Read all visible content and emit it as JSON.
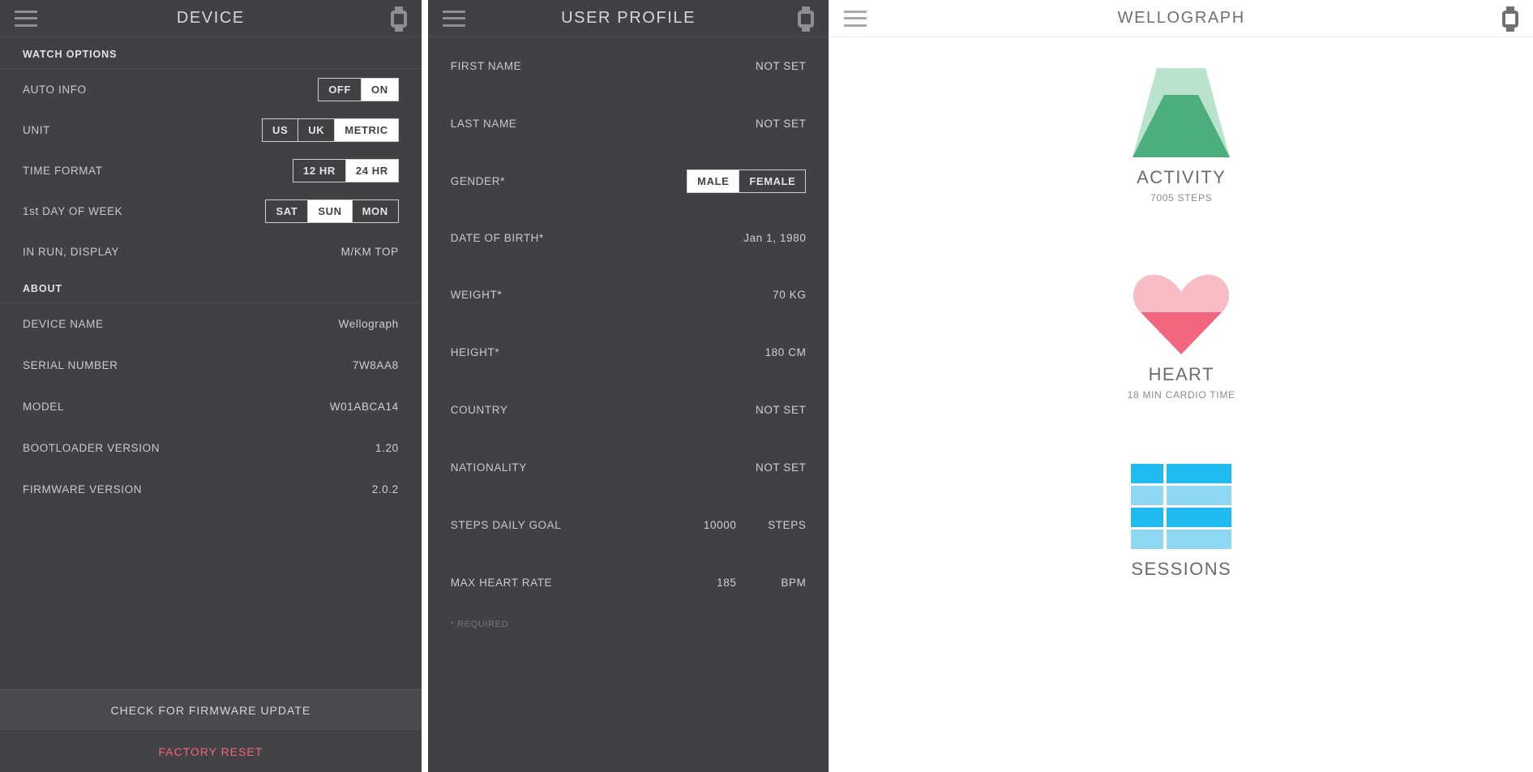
{
  "device_screen": {
    "header": {
      "title": "DEVICE",
      "menu_icon": "hamburger-menu-icon",
      "watch_icon": "watch-icon"
    },
    "sections": [
      {
        "heading": "WATCH OPTIONS",
        "rows": [
          {
            "label": "AUTO INFO",
            "type": "segmented",
            "options": [
              "OFF",
              "ON"
            ],
            "selected": "ON"
          },
          {
            "label": "UNIT",
            "type": "segmented",
            "options": [
              "US",
              "UK",
              "METRIC"
            ],
            "selected": "METRIC"
          },
          {
            "label": "TIME FORMAT",
            "type": "segmented",
            "options": [
              "12 HR",
              "24 HR"
            ],
            "selected": "24 HR"
          },
          {
            "label": "1st DAY OF WEEK",
            "type": "segmented",
            "options": [
              "SAT",
              "SUN",
              "MON"
            ],
            "selected": "SUN"
          },
          {
            "label": "IN RUN, DISPLAY",
            "type": "value",
            "value": "M/KM TOP"
          }
        ]
      },
      {
        "heading": "ABOUT",
        "rows": [
          {
            "label": "DEVICE NAME",
            "type": "value",
            "value": "Wellograph"
          },
          {
            "label": "SERIAL NUMBER",
            "type": "value",
            "value": "7W8AA8"
          },
          {
            "label": "MODEL",
            "type": "value",
            "value": "W01ABCA14"
          },
          {
            "label": "BOOTLOADER VERSION",
            "type": "value",
            "value": "1.20"
          },
          {
            "label": "FIRMWARE VERSION",
            "type": "value",
            "value": "2.0.2"
          }
        ]
      }
    ],
    "buttons": {
      "firmware_update": "CHECK FOR FIRMWARE UPDATE",
      "factory_reset": "FACTORY RESET",
      "factory_reset_color": "#f4637e"
    }
  },
  "profile_screen": {
    "header": {
      "title": "USER PROFILE",
      "menu_icon": "hamburger-menu-icon",
      "watch_icon": "watch-icon"
    },
    "rows": [
      {
        "label": "FIRST NAME",
        "type": "value",
        "value": "NOT SET"
      },
      {
        "label": "LAST NAME",
        "type": "value",
        "value": "NOT SET"
      },
      {
        "label": "GENDER*",
        "type": "segmented",
        "options": [
          "MALE",
          "FEMALE"
        ],
        "selected": "MALE"
      },
      {
        "label": "DATE OF BIRTH*",
        "type": "value",
        "value": "Jan 1, 1980"
      },
      {
        "label": "WEIGHT*",
        "type": "value",
        "value": "70 KG"
      },
      {
        "label": "HEIGHT*",
        "type": "value",
        "value": "180 CM"
      },
      {
        "label": "COUNTRY",
        "type": "value",
        "value": "NOT SET"
      },
      {
        "label": "NATIONALITY",
        "type": "value",
        "value": "NOT SET"
      },
      {
        "label": "STEPS DAILY GOAL",
        "type": "pair",
        "number": "10000",
        "unit": "STEPS"
      },
      {
        "label": "MAX HEART RATE",
        "type": "pair",
        "number": "185",
        "unit": "BPM"
      }
    ],
    "footnote": "* REQUIRED"
  },
  "dashboard_screen": {
    "header": {
      "title": "WELLOGRAPH",
      "menu_icon": "hamburger-menu-icon",
      "watch_icon": "watch-icon"
    },
    "metrics": [
      {
        "icon": "activity-trapezoid-icon",
        "title": "ACTIVITY",
        "subtitle": "7005 STEPS",
        "color_fill": "#4caf7d",
        "color_track": "#b9e3cc",
        "fill_ratio": 0.7
      },
      {
        "icon": "heart-icon",
        "title": "HEART",
        "subtitle": "18 MIN CARDIO TIME",
        "color_fill": "#f26680",
        "color_track": "#f7bcc4",
        "fill_ratio": 0.5
      },
      {
        "icon": "sessions-grid-icon",
        "title": "SESSIONS",
        "subtitle": "",
        "color_fill": "#1ebaf0",
        "color_track": "#8ed8f4",
        "rows": 4,
        "columns": 2
      }
    ]
  }
}
